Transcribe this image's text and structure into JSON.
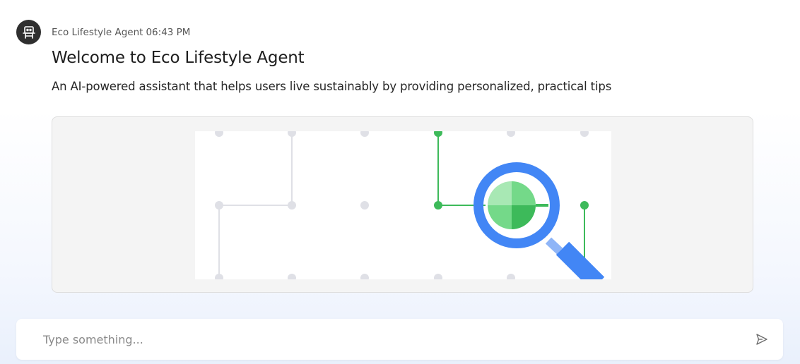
{
  "message": {
    "sender": "Eco Lifestyle Agent",
    "time": "06:43 PM",
    "avatar_icon": "robot-icon",
    "title": "Welcome to Eco Lifestyle Agent",
    "subtitle": "An AI-powered assistant that helps users live sustainably by providing personalized, practical tips",
    "image_icon": "magnifying-glass-network-illustration"
  },
  "composer": {
    "placeholder": "Type something...",
    "send_icon": "send-icon"
  },
  "colors": {
    "accent_blue": "#4286f5",
    "accent_green": "#3dba5a",
    "light_green": "#74d989",
    "pale_green": "#a8e8b4",
    "grid_gray": "#dfe0e6"
  }
}
